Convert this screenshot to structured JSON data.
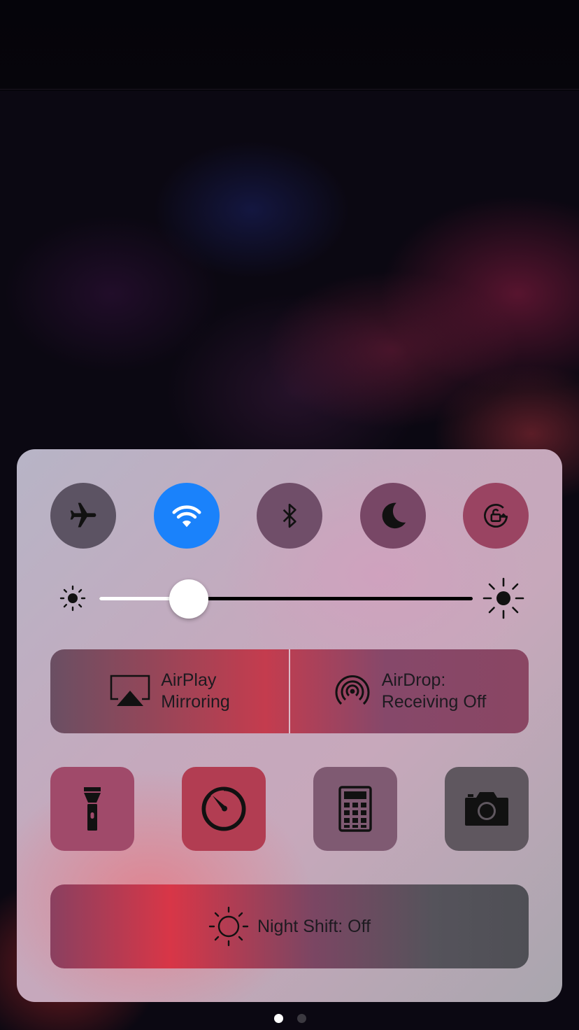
{
  "control_center": {
    "toggles": [
      {
        "name": "airplane-icon",
        "on": false
      },
      {
        "name": "wifi-icon",
        "on": true,
        "accent": "#1a82fb"
      },
      {
        "name": "bluetooth-icon",
        "on": false
      },
      {
        "name": "moon-icon",
        "on": false
      },
      {
        "name": "rotation-lock-icon",
        "on": false
      }
    ],
    "brightness": {
      "level_percent": 24
    },
    "airplay": {
      "line1": "AirPlay",
      "line2": "Mirroring"
    },
    "airdrop": {
      "line1": "AirDrop:",
      "line2": "Receiving Off"
    },
    "shortcuts": [
      "flashlight-icon",
      "timer-icon",
      "calculator-icon",
      "camera-icon"
    ],
    "night_shift": {
      "label": "Night Shift: Off"
    }
  },
  "page_indicator": {
    "current": 1,
    "total": 2
  }
}
